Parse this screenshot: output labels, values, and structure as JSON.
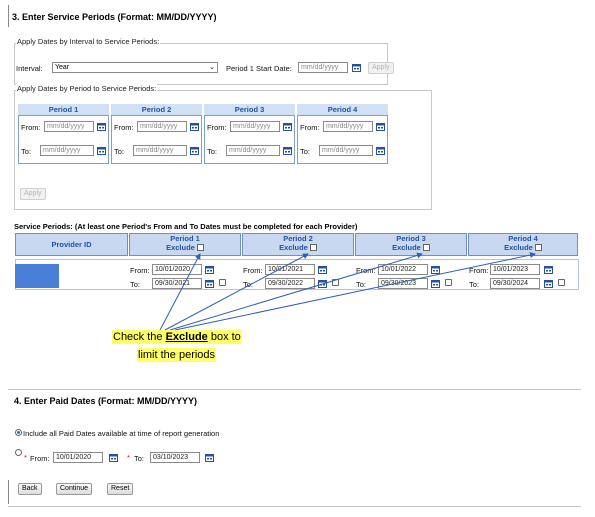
{
  "section3": {
    "title": "3.  Enter Service Periods (Format: MM/DD/YYYY)",
    "interval_group": {
      "legend": "Apply Dates by Interval to Service Periods:",
      "interval_label": "Interval:",
      "interval_value": "Year",
      "start_label": "Period 1 Start Date:",
      "start_placeholder": "mm/dd/yyyy",
      "apply_label": "Apply"
    },
    "period_group": {
      "legend": "Apply Dates by Period to Service Periods:",
      "periods": [
        {
          "title": "Period 1",
          "from_label": "From:",
          "to_label": "To:",
          "placeholder": "mm/dd/yyyy"
        },
        {
          "title": "Period 2",
          "from_label": "From:",
          "to_label": "To:",
          "placeholder": "mm/dd/yyyy"
        },
        {
          "title": "Period 3",
          "from_label": "From:",
          "to_label": "To:",
          "placeholder": "mm/dd/yyyy"
        },
        {
          "title": "Period 4",
          "from_label": "From:",
          "to_label": "To:",
          "placeholder": "mm/dd/yyyy"
        }
      ],
      "apply_label": "Apply"
    },
    "service_periods": {
      "caption": "Service Periods: (At least one Period's From and To Dates must be completed for each Provider)",
      "provider_header": "Provider ID",
      "exclude_label": "Exclude",
      "periods": [
        {
          "title": "Period 1",
          "from_label": "From:",
          "to_label": "To:",
          "from": "10/01/2020",
          "to": "09/30/2021"
        },
        {
          "title": "Period 2",
          "from_label": "From:",
          "to_label": "To:",
          "from": "10/01/2021",
          "to": "09/30/2022"
        },
        {
          "title": "Period 3",
          "from_label": "From:",
          "to_label": "To:",
          "from": "10/01/2022",
          "to": "09/30/2023"
        },
        {
          "title": "Period 4",
          "from_label": "From:",
          "to_label": "To:",
          "from": "10/01/2023",
          "to": "09/30/2024"
        }
      ]
    },
    "callout": {
      "prefix": "Check the ",
      "emphasis": "Exclude",
      "suffix": " box to",
      "line2": "limit the periods"
    }
  },
  "section4": {
    "title": "4.  Enter Paid Dates (Format: MM/DD/YYYY)",
    "option_all": "Include all Paid Dates available at time of report generation",
    "from_label": "From:",
    "from_value": "10/01/2020",
    "to_label": "To:",
    "to_value": "03/10/2023",
    "required_mark": "*"
  },
  "buttons": {
    "back": "Back",
    "continue": "Continue",
    "reset": "Reset"
  },
  "colors": {
    "period_header_bg": "#cfe0f7",
    "period_header_text": "#2452a0",
    "redacted_provider": "#4a7fd8",
    "callout_bg": "#ffff66",
    "arrow": "#2f5fb8"
  },
  "icons": [
    "calendar-icon",
    "chevron-down-icon",
    "checkbox",
    "radio"
  ]
}
